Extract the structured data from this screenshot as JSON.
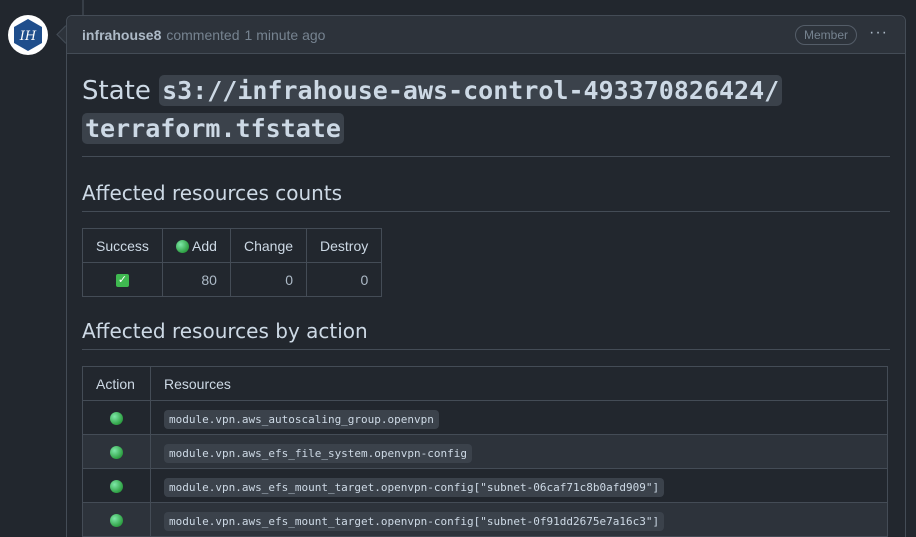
{
  "avatar": {
    "initials": "IH"
  },
  "comment": {
    "author": "infrahouse8",
    "action_text": "commented",
    "timestamp": "1 minute ago",
    "role_badge": "Member",
    "more_label": "···"
  },
  "state": {
    "prefix": "State",
    "path_line1": "s3://infrahouse-aws-control-493370826424/",
    "path_line2": "terraform.tfstate"
  },
  "counts": {
    "heading": "Affected resources counts",
    "headers": {
      "success": "Success",
      "add": "Add",
      "change": "Change",
      "destroy": "Destroy"
    },
    "row": {
      "success_icon": "check-icon",
      "add": "80",
      "change": "0",
      "destroy": "0"
    }
  },
  "actions": {
    "heading": "Affected resources by action",
    "headers": {
      "action": "Action",
      "resources": "Resources"
    },
    "rows": [
      {
        "icon": "green-dot-icon",
        "resource": "module.vpn.aws_autoscaling_group.openvpn"
      },
      {
        "icon": "green-dot-icon",
        "resource": "module.vpn.aws_efs_file_system.openvpn-config"
      },
      {
        "icon": "green-dot-icon",
        "resource": "module.vpn.aws_efs_mount_target.openvpn-config[\"subnet-06caf71c8b0afd909\"]"
      },
      {
        "icon": "green-dot-icon",
        "resource": "module.vpn.aws_efs_mount_target.openvpn-config[\"subnet-0f91dd2675e7a16c3\"]"
      }
    ]
  },
  "colors": {
    "background": "#22272e",
    "header": "#2d333b",
    "border": "#444c56",
    "success_green": "#3fb950",
    "add_dot": "#2ea043"
  }
}
